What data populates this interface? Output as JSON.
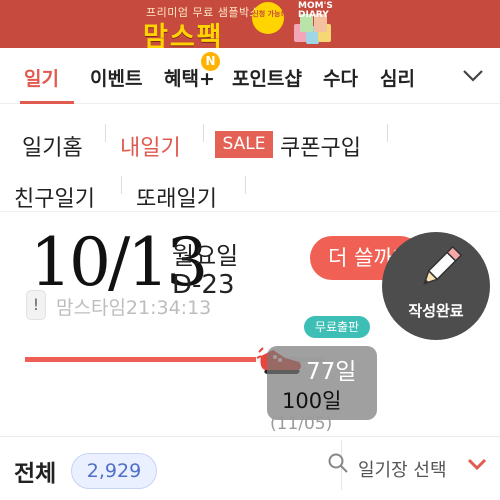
{
  "banner": {
    "subtitle": "프리미엄 무료 샘플박스",
    "title": "맘스팩",
    "badge": "신청 가능!",
    "product_text": "MOM'S DIARY"
  },
  "nav": {
    "items": [
      "일기",
      "이벤트",
      "혜택+",
      "포인트샵",
      "수다",
      "심리"
    ],
    "new_badge": "N",
    "menu_icon": "chevron-down-icon"
  },
  "submenu": {
    "row1": [
      "일기홈",
      "내일기",
      "쿠폰구입"
    ],
    "sale_badge": "SALE",
    "row2": [
      "친구일기",
      "또래일기"
    ]
  },
  "diary": {
    "date": "10/13",
    "weekday": "월요일",
    "dday": "D-23",
    "meta": "맘스타임21:34:13",
    "write_more": "더 쓸까?",
    "write_done": "작성완료"
  },
  "progress": {
    "fraction": 0.77,
    "free_label": "무료출판",
    "current_days": "77일",
    "target_days": "100일",
    "target_date": "(11/05)"
  },
  "list": {
    "total_label": "전체",
    "total_count": "2,929",
    "book_select": "일기장 선택"
  },
  "colors": {
    "accent": "#e15a4f",
    "banner": "#c64a3e",
    "teal": "#3dbfb6",
    "dark_button": "#4d4d4d"
  }
}
